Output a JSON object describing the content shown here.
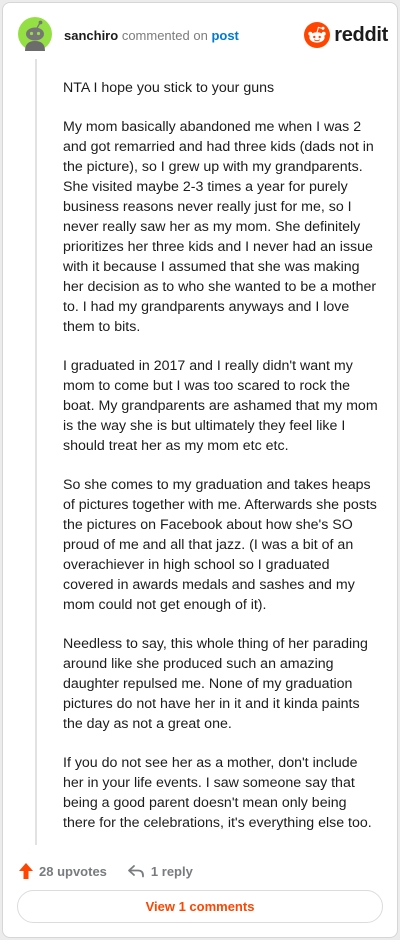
{
  "header": {
    "username": "sanchiro",
    "action": "commented on",
    "post_link": "post",
    "brand_name": "reddit"
  },
  "comment": {
    "paragraphs": [
      "NTA I hope you stick to your guns",
      "My mom basically abandoned me when I was 2 and got remarried and had three kids (dads not in the picture), so I grew up with my grandparents. She visited maybe 2-3 times a year for purely business reasons never really just for me, so I never really saw her as my mom. She definitely prioritizes her three kids and I never had an issue with it because I assumed that she was making her decision as to who she wanted to be a mother to. I had my grandparents anyways and I love them to bits.",
      "I graduated in 2017 and I really didn't want my mom to come but I was too scared to rock the boat. My grandparents are ashamed that my mom is the way she is but ultimately they feel like I should treat her as my mom etc etc.",
      "So she comes to my graduation and takes heaps of pictures together with me. Afterwards she posts the pictures on Facebook about how she's SO proud of me and all that jazz. (I was a bit of an overachiever in high school so I graduated covered in awards medals and sashes and my mom could not get enough of it).",
      "Needless to say, this whole thing of her parading around like she produced such an amazing daughter repulsed me. None of my graduation pictures do not have her in it and it kinda paints the day as not a great one.",
      "If you do not see her as a mother, don't include her in your life events. I saw someone say that being a good parent doesn't mean only being there for the celebrations, it's everything else too."
    ]
  },
  "footer": {
    "upvotes": "28 upvotes",
    "replies": "1 reply",
    "view_comments": "View 1 comments"
  },
  "icons": {
    "avatar": "snoo-avatar-icon",
    "brand": "reddit-logo-icon",
    "upvote": "upvote-arrow-icon",
    "reply": "reply-arrow-icon"
  },
  "colors": {
    "brand": "#ff4500",
    "link": "#0079d3",
    "avatar_bg": "#94e044",
    "muted": "#787c7e"
  }
}
